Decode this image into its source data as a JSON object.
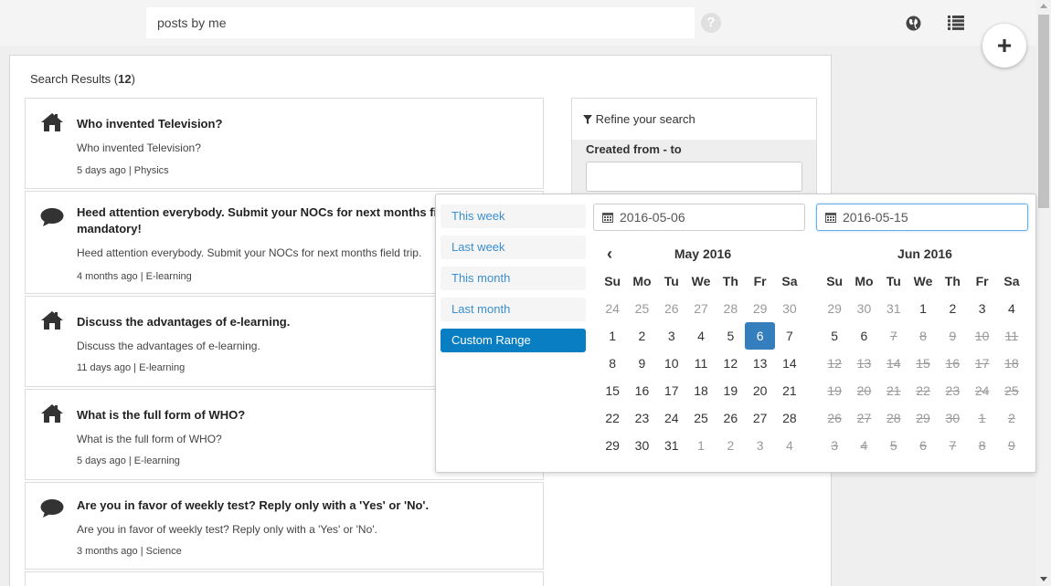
{
  "search": {
    "value": "posts by me",
    "help_glyph": "?"
  },
  "fab": {
    "label": "+"
  },
  "results": {
    "title_prefix": "Search Results (",
    "count": "12",
    "title_suffix": ")",
    "items": [
      {
        "icon": "home-icon",
        "title": "Who invented Television?",
        "body": "Who invented Television?",
        "meta": "5 days ago | Physics"
      },
      {
        "icon": "comment-icon",
        "title": "Heed attention everybody. Submit your NOCs for next months field trip. It is mandatory!",
        "body": "Heed attention everybody. Submit your NOCs for next months field trip.",
        "meta": "4 months ago | E-learning"
      },
      {
        "icon": "home-icon",
        "title": "Discuss the advantages of e-learning.",
        "body": "Discuss the advantages of e-learning.",
        "meta": "11 days ago | E-learning"
      },
      {
        "icon": "home-icon",
        "title": "What is the full form of WHO?",
        "body": "What is the full form of WHO?",
        "meta": "5 days ago | E-learning"
      },
      {
        "icon": "comment-icon",
        "title": "Are you in favor of weekly test? Reply only with a 'Yes' or 'No'.",
        "body": "Are you in favor of weekly test? Reply only with a 'Yes' or 'No'.",
        "meta": "3 months ago | Science"
      }
    ]
  },
  "refine": {
    "title": "Refine your search",
    "created_label": "Created from - to"
  },
  "daterange": {
    "ranges": [
      "This week",
      "Last week",
      "This month",
      "Last month",
      "Custom Range"
    ],
    "active_range": "Custom Range",
    "start": "2016-05-06",
    "end": "2016-05-15",
    "dow": [
      "Su",
      "Mo",
      "Tu",
      "We",
      "Th",
      "Fr",
      "Sa"
    ],
    "left": {
      "title": "May 2016",
      "days": [
        {
          "d": "24",
          "s": "off"
        },
        {
          "d": "25",
          "s": "off"
        },
        {
          "d": "26",
          "s": "off"
        },
        {
          "d": "27",
          "s": "off"
        },
        {
          "d": "28",
          "s": "off"
        },
        {
          "d": "29",
          "s": "off"
        },
        {
          "d": "30",
          "s": "off"
        },
        {
          "d": "1"
        },
        {
          "d": "2"
        },
        {
          "d": "3"
        },
        {
          "d": "4"
        },
        {
          "d": "5"
        },
        {
          "d": "6",
          "s": "active"
        },
        {
          "d": "7"
        },
        {
          "d": "8"
        },
        {
          "d": "9"
        },
        {
          "d": "10"
        },
        {
          "d": "11"
        },
        {
          "d": "12"
        },
        {
          "d": "13"
        },
        {
          "d": "14"
        },
        {
          "d": "15"
        },
        {
          "d": "16"
        },
        {
          "d": "17"
        },
        {
          "d": "18"
        },
        {
          "d": "19"
        },
        {
          "d": "20"
        },
        {
          "d": "21"
        },
        {
          "d": "22"
        },
        {
          "d": "23"
        },
        {
          "d": "24"
        },
        {
          "d": "25"
        },
        {
          "d": "26"
        },
        {
          "d": "27"
        },
        {
          "d": "28"
        },
        {
          "d": "29"
        },
        {
          "d": "30"
        },
        {
          "d": "31"
        },
        {
          "d": "1",
          "s": "off"
        },
        {
          "d": "2",
          "s": "off"
        },
        {
          "d": "3",
          "s": "off"
        },
        {
          "d": "4",
          "s": "off"
        }
      ]
    },
    "right": {
      "title": "Jun 2016",
      "days": [
        {
          "d": "29",
          "s": "off"
        },
        {
          "d": "30",
          "s": "off"
        },
        {
          "d": "31",
          "s": "off"
        },
        {
          "d": "1"
        },
        {
          "d": "2"
        },
        {
          "d": "3"
        },
        {
          "d": "4"
        },
        {
          "d": "5"
        },
        {
          "d": "6"
        },
        {
          "d": "7",
          "s": "disabled"
        },
        {
          "d": "8",
          "s": "disabled"
        },
        {
          "d": "9",
          "s": "disabled"
        },
        {
          "d": "10",
          "s": "disabled"
        },
        {
          "d": "11",
          "s": "disabled"
        },
        {
          "d": "12",
          "s": "disabled"
        },
        {
          "d": "13",
          "s": "disabled"
        },
        {
          "d": "14",
          "s": "disabled"
        },
        {
          "d": "15",
          "s": "disabled"
        },
        {
          "d": "16",
          "s": "disabled"
        },
        {
          "d": "17",
          "s": "disabled"
        },
        {
          "d": "18",
          "s": "disabled"
        },
        {
          "d": "19",
          "s": "disabled"
        },
        {
          "d": "20",
          "s": "disabled"
        },
        {
          "d": "21",
          "s": "disabled"
        },
        {
          "d": "22",
          "s": "disabled"
        },
        {
          "d": "23",
          "s": "disabled"
        },
        {
          "d": "24",
          "s": "disabled"
        },
        {
          "d": "25",
          "s": "disabled"
        },
        {
          "d": "26",
          "s": "disabled"
        },
        {
          "d": "27",
          "s": "disabled"
        },
        {
          "d": "28",
          "s": "disabled"
        },
        {
          "d": "29",
          "s": "disabled"
        },
        {
          "d": "30",
          "s": "disabled"
        },
        {
          "d": "1",
          "s": "disabled"
        },
        {
          "d": "2",
          "s": "disabled"
        },
        {
          "d": "3",
          "s": "disabled"
        },
        {
          "d": "4",
          "s": "disabled"
        },
        {
          "d": "5",
          "s": "disabled"
        },
        {
          "d": "6",
          "s": "disabled"
        },
        {
          "d": "7",
          "s": "disabled"
        },
        {
          "d": "8",
          "s": "disabled"
        },
        {
          "d": "9",
          "s": "disabled"
        }
      ]
    }
  },
  "colors": {
    "accent": "#0a7ec2",
    "active_day": "#357ebd",
    "link": "#3a8fd1"
  }
}
